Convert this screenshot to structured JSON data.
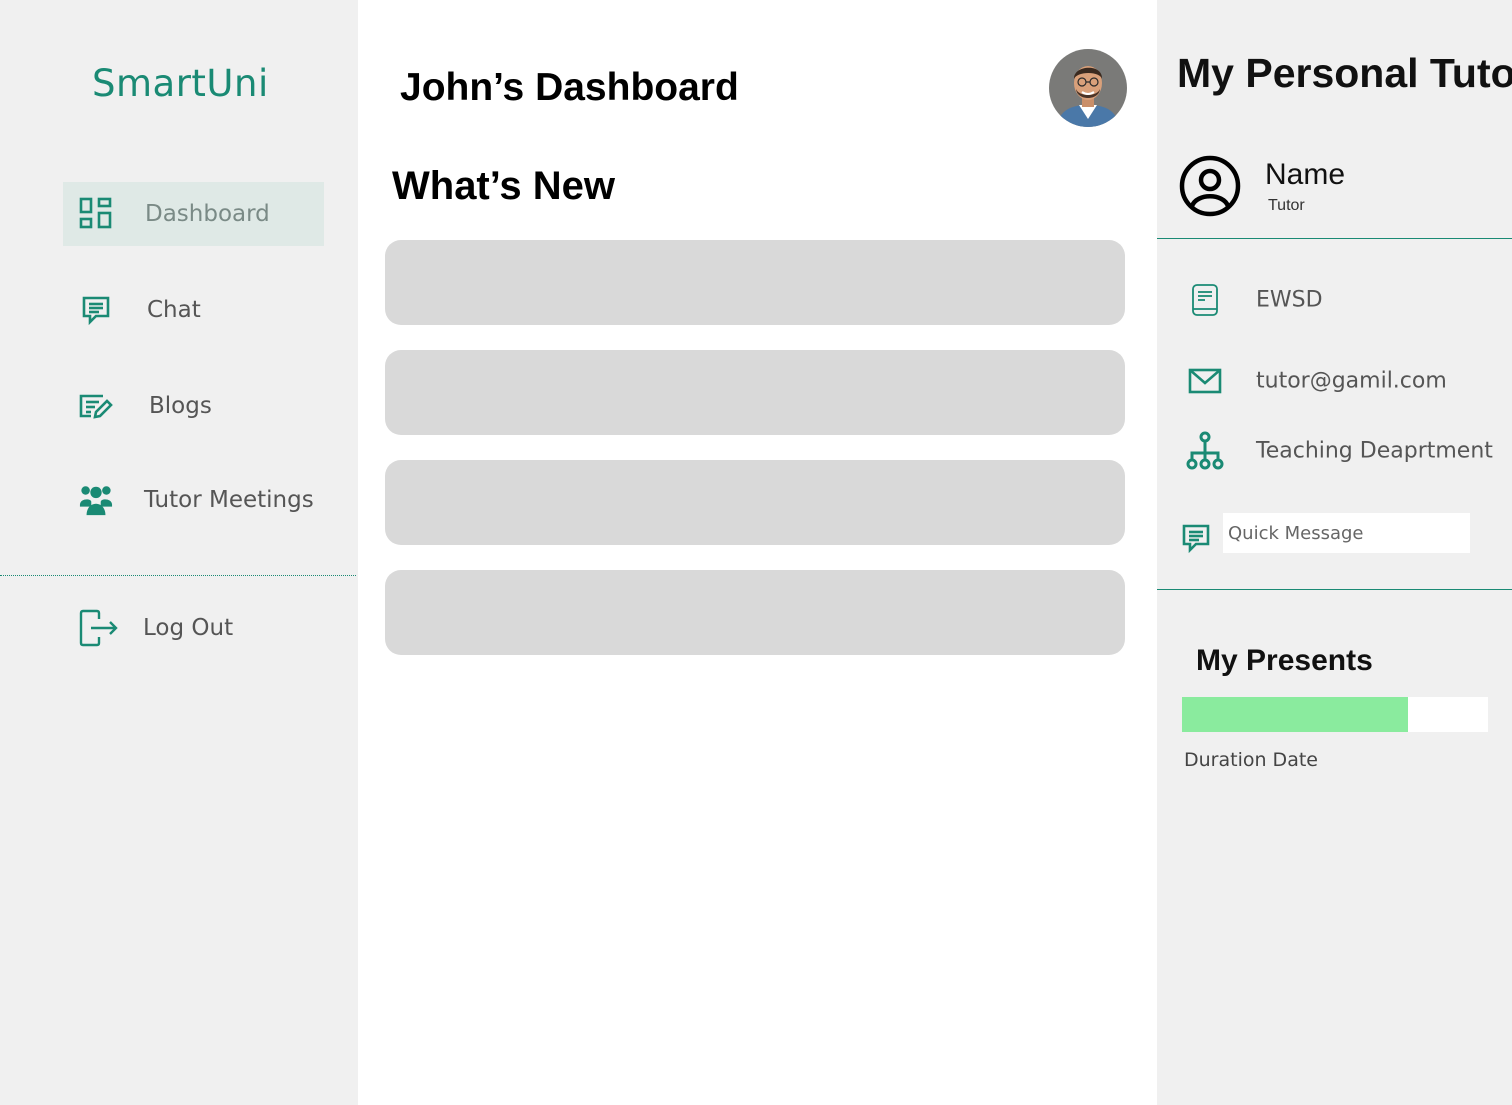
{
  "brand": {
    "name": "SmartUni"
  },
  "sidebar": {
    "items": [
      {
        "label": "Dashboard",
        "icon": "dashboard-icon",
        "active": true
      },
      {
        "label": "Chat",
        "icon": "chat-icon"
      },
      {
        "label": "Blogs",
        "icon": "blog-edit-icon"
      },
      {
        "label": "Tutor Meetings",
        "icon": "group-icon"
      }
    ],
    "logout": {
      "label": "Log Out",
      "icon": "logout-icon"
    }
  },
  "main": {
    "title": "John’s Dashboard",
    "section_title": "What’s New",
    "news_cards": [
      {},
      {},
      {},
      {}
    ]
  },
  "tutor": {
    "panel_title": "My Personal Tutor",
    "name": "Name",
    "role": "Tutor",
    "course": "EWSD",
    "email": "tutor@gamil.com",
    "department": "Teaching Deaprtment",
    "quick_message_placeholder": "Quick Message"
  },
  "presents": {
    "title": "My Presents",
    "progress_fraction": 0.74,
    "duration_label": "Duration Date"
  },
  "colors": {
    "accent": "#1a8a74",
    "progress": "#8aeb9e",
    "sidebar_bg": "#f0f0f0",
    "active_bg": "#dfe9e6",
    "card_bg": "#d9d9d9"
  }
}
